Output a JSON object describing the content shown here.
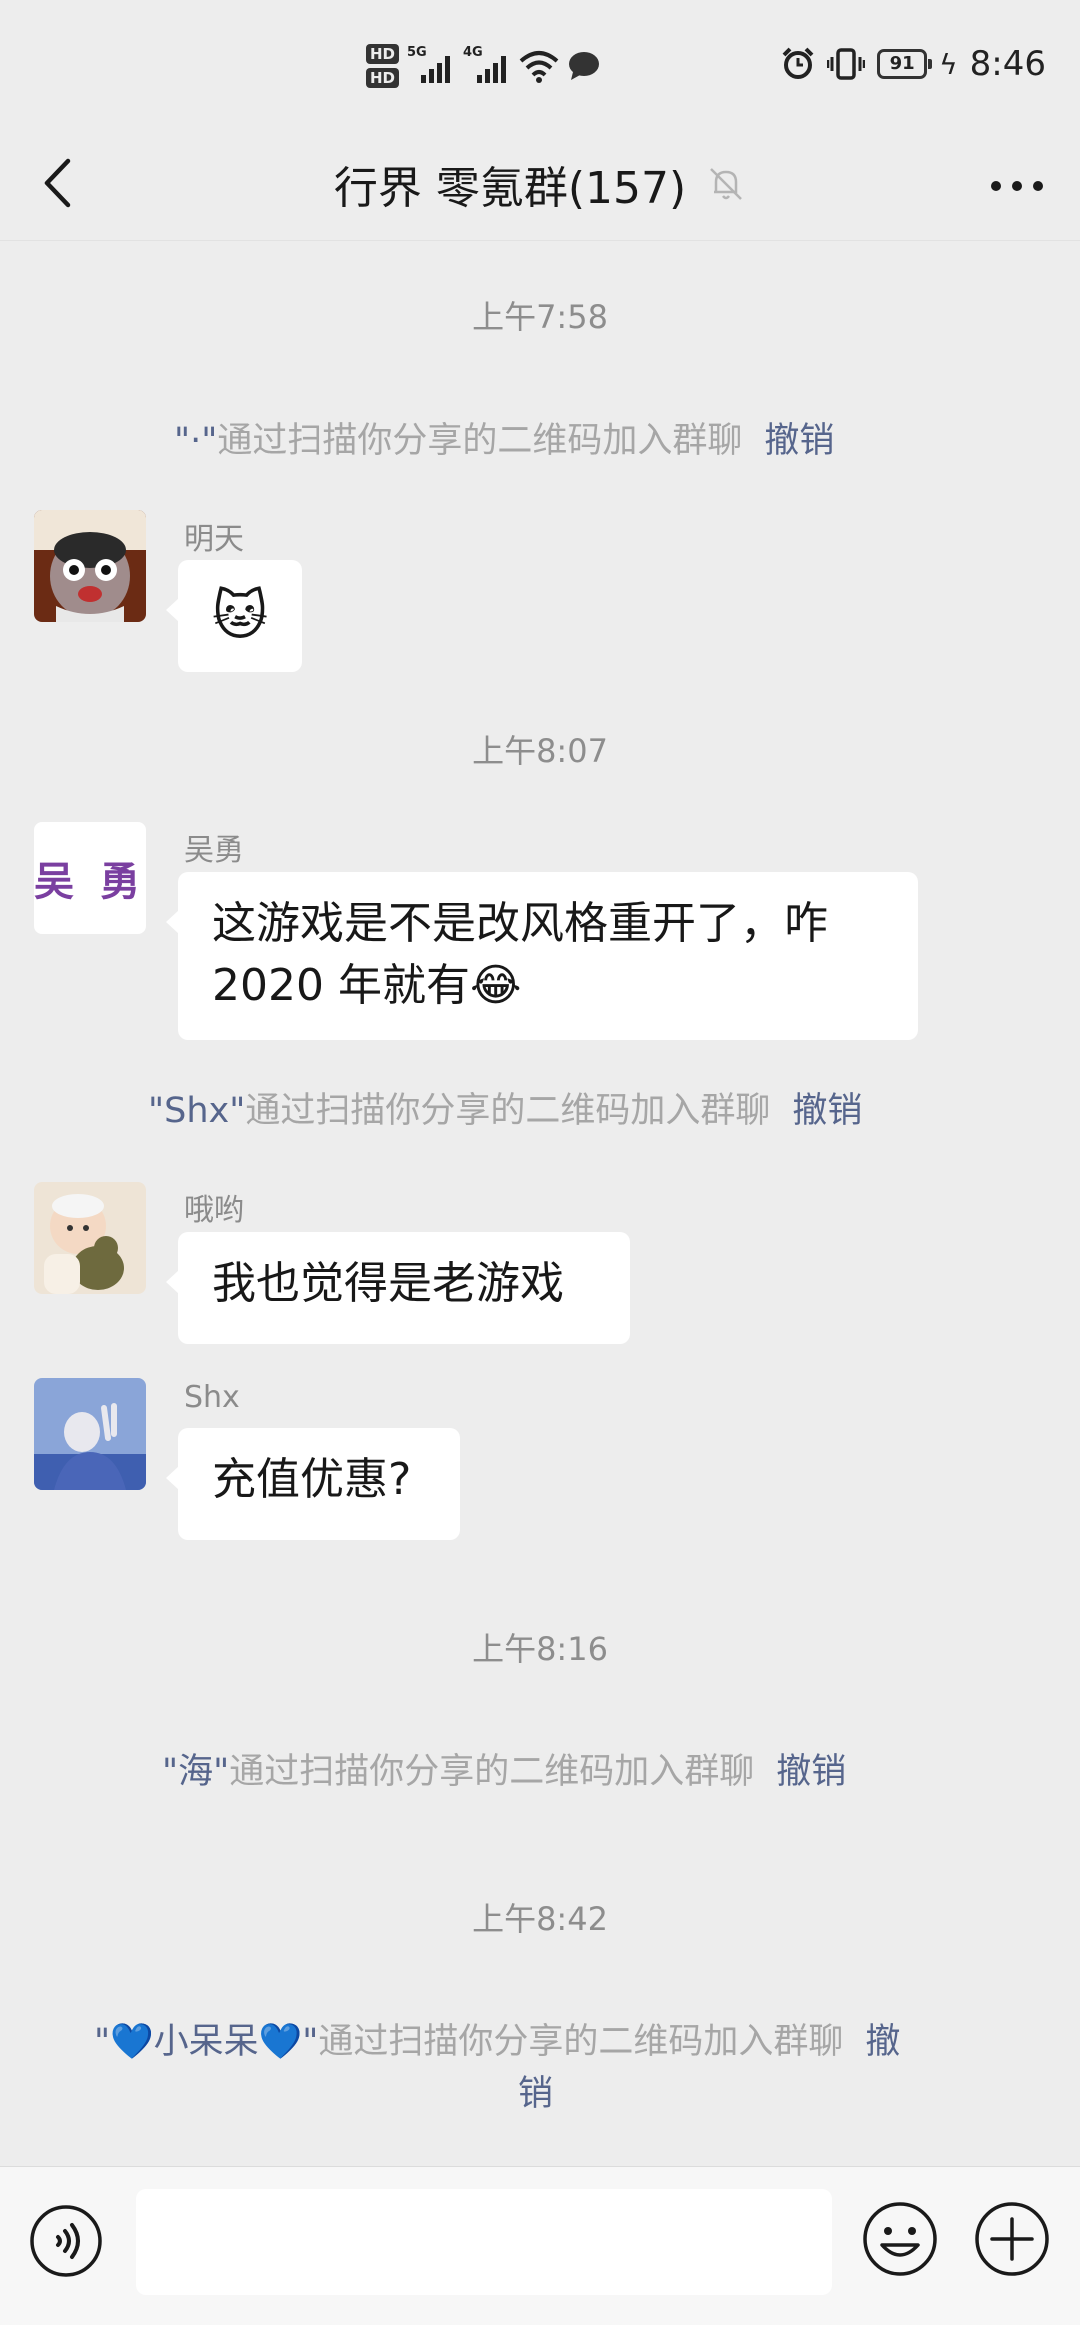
{
  "status_bar": {
    "hd1": "HD",
    "hd2": "HD",
    "net1": "5G",
    "net2": "4G",
    "battery": "91",
    "time": "8:46"
  },
  "header": {
    "title": "行界 零氪群(157)"
  },
  "messages": {
    "time1": "上午7:58",
    "sys1": {
      "name": "\"·\"",
      "text": "通过扫描你分享的二维码加入群聊",
      "undo": "撤销"
    },
    "m1": {
      "sender": "明天",
      "sticker": "🐱"
    },
    "time2": "上午8:07",
    "m2": {
      "sender": "吴勇",
      "avatar_text": "吴 勇",
      "line1": "这游戏是不是改风格重开了，咋",
      "line2": "2020 年就有",
      "emoji": "😂"
    },
    "sys2": {
      "name": "\"Shx\"",
      "text": "通过扫描你分享的二维码加入群聊",
      "undo": "撤销"
    },
    "m3": {
      "sender": "哦哟",
      "text": "我也觉得是老游戏"
    },
    "m4": {
      "sender": "Shx",
      "text": "充值优惠?"
    },
    "time3": "上午8:16",
    "sys3": {
      "name": "\"海\"",
      "text": "通过扫描你分享的二维码加入群聊",
      "undo": "撤销"
    },
    "time4": "上午8:42",
    "sys4": {
      "name": "\"💙小呆呆💙\"",
      "text": "通过扫描你分享的二维码加入群聊",
      "undo1": "撤",
      "undo2": "销"
    }
  },
  "input_bar": {
    "placeholder": ""
  },
  "colors": {
    "background": "#ededed",
    "bubble": "#ffffff",
    "link": "#56658c",
    "system_text": "#a6a6a6"
  },
  "icons": [
    "signal-icon",
    "wifi-icon",
    "chat-icon",
    "alarm-icon",
    "vibrate-icon",
    "battery-icon",
    "back-icon",
    "mute-bell-icon",
    "more-icon",
    "voice-icon",
    "emoji-icon",
    "plus-icon"
  ]
}
